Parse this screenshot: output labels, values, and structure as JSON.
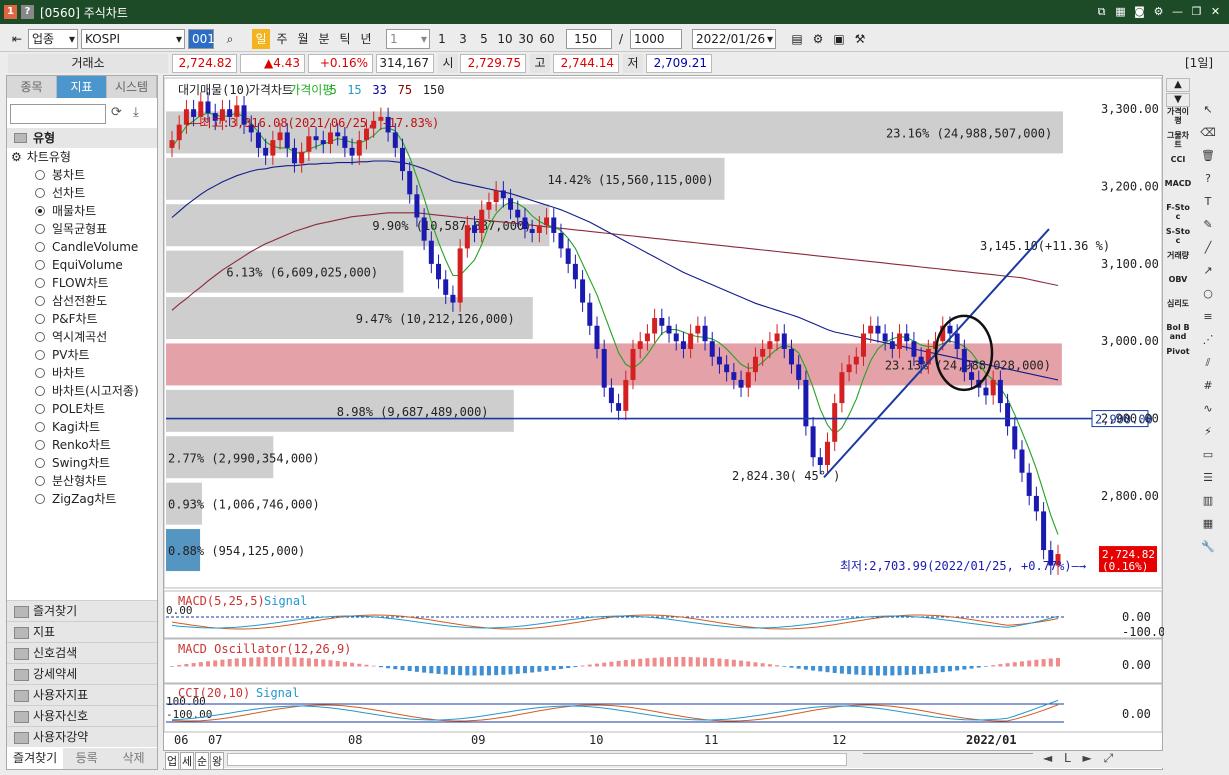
{
  "window": {
    "title": "[0560] 주식차트",
    "icon1": "1",
    "icon2": "?"
  },
  "toolbar": {
    "market": "업종",
    "symbol": "KOSPI",
    "symbol_code": "001",
    "period_btns": [
      "일",
      "주",
      "월",
      "분",
      "틱",
      "년"
    ],
    "interval_value": "1",
    "nums": [
      "1",
      "3",
      "5",
      "10",
      "30",
      "60"
    ],
    "count": "150",
    "total": "1000",
    "date": "2022/01/26",
    "tag": "[1일]"
  },
  "price": {
    "exchange": "거래소",
    "last": "2,724.82",
    "change": "▲4.43",
    "pct": "+0.16%",
    "volume": "314,167",
    "open_lbl": "시",
    "open": "2,729.75",
    "high_lbl": "고",
    "high": "2,744.14",
    "low_lbl": "저",
    "low": "2,709.21"
  },
  "left": {
    "tabs": [
      "종목",
      "지표",
      "시스템"
    ],
    "header": "유형",
    "chart_type_group": "차트유형",
    "types": [
      "봉차트",
      "선차트",
      "매물차트",
      "일목균형표",
      "CandleVolume",
      "EquiVolume",
      "FLOW차트",
      "삼선전환도",
      "P&F차트",
      "역시계곡선",
      "PV차트",
      "바차트",
      "바차트(시고저종)",
      "POLE차트",
      "Kagi차트",
      "Renko차트",
      "Swing차트",
      "분산형차트",
      "ZigZag차트"
    ],
    "selected": 2,
    "groups": [
      "즐겨찾기",
      "지표",
      "신호검색",
      "강세약세",
      "사용자지표",
      "사용자신호",
      "사용자강약"
    ],
    "bottom_tabs": [
      "즐겨찾기",
      "등록",
      "삭제"
    ]
  },
  "chart_data": {
    "type": "candlestick",
    "legend": [
      "대기매물(10)",
      "가격차트",
      "가격이평",
      "5",
      "15",
      "33",
      "75",
      "150"
    ],
    "y_ticks": [
      "3,300.00",
      "3,200.00",
      "3,100.00",
      "3,000.00",
      "2,900.00",
      "2,800.00"
    ],
    "y_range": [
      2690,
      3330
    ],
    "x_labels": [
      "06",
      "07",
      "08",
      "09",
      "10",
      "11",
      "12",
      "2022/01"
    ],
    "hline": 2900,
    "hline_label": "2,900.00",
    "last_price": "2,724.82",
    "last_pct": "(0.16%)",
    "max_label": "최고:3,316.08(2021/06/25, -17.83%)",
    "min_label": "최저:2,703.99(2022/01/25, +0.77%)",
    "low_note": "2,824.30( 45° )",
    "trend_label": "3,145.10(+11.36 %)",
    "bands": [
      {
        "price": 3270,
        "pct": "23.16%",
        "vol": "(24,988,507,000)"
      },
      {
        "price": 3210,
        "pct": "14.42%",
        "vol": "(15,560,115,000)"
      },
      {
        "price": 3150,
        "pct": "9.90%",
        "vol": "(10,587,887,000)"
      },
      {
        "price": 3090,
        "pct": "6.13%",
        "vol": "(6,609,025,000)"
      },
      {
        "price": 3030,
        "pct": "9.47%",
        "vol": "(10,212,126,000)"
      },
      {
        "price": 2970,
        "pct": "23.13%",
        "vol": "(24,988,028,000)"
      },
      {
        "price": 2910,
        "pct": "8.98%",
        "vol": "(9,687,489,000)"
      },
      {
        "price": 2850,
        "pct": "2.77%",
        "vol": "(2,990,354,000)"
      },
      {
        "price": 2790,
        "pct": "0.93%",
        "vol": "(1,006,746,000)"
      },
      {
        "price": 2730,
        "pct": "0.88%",
        "vol": "(954,125,000)"
      }
    ],
    "closes": [
      3260,
      3280,
      3300,
      3290,
      3310,
      3295,
      3285,
      3300,
      3290,
      3305,
      3280,
      3270,
      3250,
      3240,
      3260,
      3270,
      3250,
      3230,
      3245,
      3265,
      3260,
      3255,
      3270,
      3265,
      3250,
      3240,
      3260,
      3275,
      3285,
      3290,
      3270,
      3250,
      3220,
      3190,
      3160,
      3130,
      3100,
      3080,
      3060,
      3050,
      3120,
      3150,
      3140,
      3170,
      3180,
      3195,
      3185,
      3170,
      3160,
      3145,
      3140,
      3150,
      3160,
      3140,
      3120,
      3100,
      3080,
      3050,
      3020,
      2990,
      2940,
      2920,
      2910,
      2950,
      2990,
      3000,
      3010,
      3030,
      3020,
      3010,
      3000,
      2990,
      3010,
      3020,
      3000,
      2980,
      2970,
      2960,
      2950,
      2940,
      2960,
      2980,
      2990,
      3000,
      3010,
      2990,
      2970,
      2950,
      2890,
      2850,
      2840,
      2870,
      2920,
      2960,
      2970,
      2980,
      3010,
      3020,
      3010,
      3000,
      2990,
      3010,
      3000,
      2980,
      2970,
      2990,
      3000,
      3020,
      3010,
      2990,
      2960,
      2950,
      2940,
      2930,
      2950,
      2920,
      2890,
      2860,
      2830,
      2800,
      2780,
      2730,
      2710,
      2724.82
    ],
    "ma5": [
      3250,
      3265,
      3278,
      3285,
      3292,
      3295,
      3293,
      3290,
      3292,
      3295,
      3290,
      3282,
      3270,
      3258,
      3252,
      3250,
      3250,
      3245,
      3242,
      3248,
      3252,
      3255,
      3258,
      3262,
      3260,
      3257,
      3256,
      3260,
      3266,
      3275,
      3276,
      3272,
      3258,
      3238,
      3212,
      3185,
      3155,
      3128,
      3105,
      3085,
      3085,
      3095,
      3105,
      3125,
      3150,
      3165,
      3175,
      3180,
      3178,
      3172,
      3162,
      3155,
      3150,
      3148,
      3143,
      3133,
      3120,
      3100,
      3080,
      3060,
      3035,
      3010,
      2985,
      2970,
      2965,
      2972,
      2983,
      2997,
      3010,
      3015,
      3015,
      3012,
      3008,
      3006,
      3005,
      3003,
      2998,
      2990,
      2980,
      2970,
      2965,
      2966,
      2973,
      2982,
      2990,
      2995,
      2992,
      2985,
      2965,
      2940,
      2912,
      2892,
      2880,
      2888,
      2905,
      2925,
      2952,
      2975,
      2990,
      2998,
      3003,
      3006,
      3005,
      3000,
      2995,
      2993,
      2993,
      2997,
      3000,
      2998,
      2993,
      2985,
      2972,
      2958,
      2950,
      2940,
      2925,
      2905,
      2883,
      2860,
      2835,
      2805,
      2775,
      2750
    ],
    "ma75": [
      3160,
      3168,
      3176,
      3183,
      3190,
      3196,
      3201,
      3206,
      3210,
      3214,
      3217,
      3220,
      3222,
      3223,
      3225,
      3226,
      3227,
      3227,
      3228,
      3229,
      3229,
      3230,
      3230,
      3231,
      3231,
      3231,
      3232,
      3232,
      3233,
      3233,
      3233,
      3232,
      3231,
      3229,
      3226,
      3223,
      3219,
      3215,
      3211,
      3207,
      3205,
      3203,
      3201,
      3199,
      3197,
      3195,
      3193,
      3191,
      3188,
      3185,
      3182,
      3179,
      3176,
      3173,
      3170,
      3166,
      3162,
      3158,
      3154,
      3149,
      3144,
      3139,
      3134,
      3129,
      3124,
      3119,
      3114,
      3109,
      3104,
      3099,
      3094,
      3089,
      3085,
      3081,
      3077,
      3073,
      3069,
      3065,
      3061,
      3057,
      3053,
      3049,
      3046,
      3043,
      3040,
      3037,
      3034,
      3031,
      3027,
      3023,
      3019,
      3015,
      3012,
      3010,
      3008,
      3006,
      3004,
      3002,
      3000,
      2998,
      2996,
      2994,
      2992,
      2990,
      2988,
      2986,
      2984,
      2982,
      2980,
      2978,
      2976,
      2974,
      2972,
      2970,
      2968,
      2966,
      2964,
      2962,
      2960,
      2958,
      2956,
      2954,
      2952,
      2950
    ],
    "ma150": [
      3040,
      3048,
      3055,
      3063,
      3070,
      3078,
      3085,
      3092,
      3098,
      3104,
      3110,
      3116,
      3121,
      3126,
      3130,
      3134,
      3138,
      3142,
      3145,
      3148,
      3151,
      3153,
      3155,
      3157,
      3159,
      3161,
      3162,
      3163,
      3164,
      3165,
      3166,
      3166,
      3166,
      3166,
      3166,
      3165,
      3164,
      3163,
      3162,
      3161,
      3160,
      3159,
      3158,
      3157,
      3156,
      3155,
      3154,
      3153,
      3152,
      3151,
      3150,
      3149,
      3148,
      3147,
      3146,
      3145,
      3144,
      3143,
      3142,
      3141,
      3140,
      3139,
      3138,
      3137,
      3136,
      3135,
      3134,
      3133,
      3132,
      3131,
      3130,
      3129,
      3128,
      3127,
      3126,
      3125,
      3124,
      3123,
      3122,
      3121,
      3120,
      3119,
      3118,
      3117,
      3116,
      3115,
      3114,
      3113,
      3112,
      3111,
      3110,
      3109,
      3108,
      3107,
      3106,
      3105,
      3104,
      3103,
      3102,
      3101,
      3100,
      3099,
      3098,
      3097,
      3096,
      3095,
      3094,
      3093,
      3092,
      3091,
      3090,
      3089,
      3088,
      3087,
      3086,
      3085,
      3084,
      3083,
      3082,
      3080,
      3078,
      3076,
      3074,
      3072
    ],
    "macd_label": "MACD(5,25,5)",
    "macd_signal": "Signal",
    "macd_ticks": [
      "0.00",
      "-100.00"
    ],
    "macd_left": "0.00",
    "osc_label": "MACD Oscillator(12,26,9)",
    "osc_tick": "0.00",
    "cci_label": "CCI(20,10)",
    "cci_signal": "Signal",
    "cci_tick": "0.00",
    "cci_left1": "100.00",
    "cci_left2": "-100.00"
  },
  "right_tools": [
    "가격이평",
    "그물차트",
    "CCI",
    "MACD",
    "F-Stoc",
    "S-Stoc",
    "거래량",
    "OBV",
    "심리도",
    "Bol Band",
    "Pivot"
  ],
  "bottom": {
    "buttons": [
      "업",
      "세",
      "순",
      "왕"
    ]
  }
}
